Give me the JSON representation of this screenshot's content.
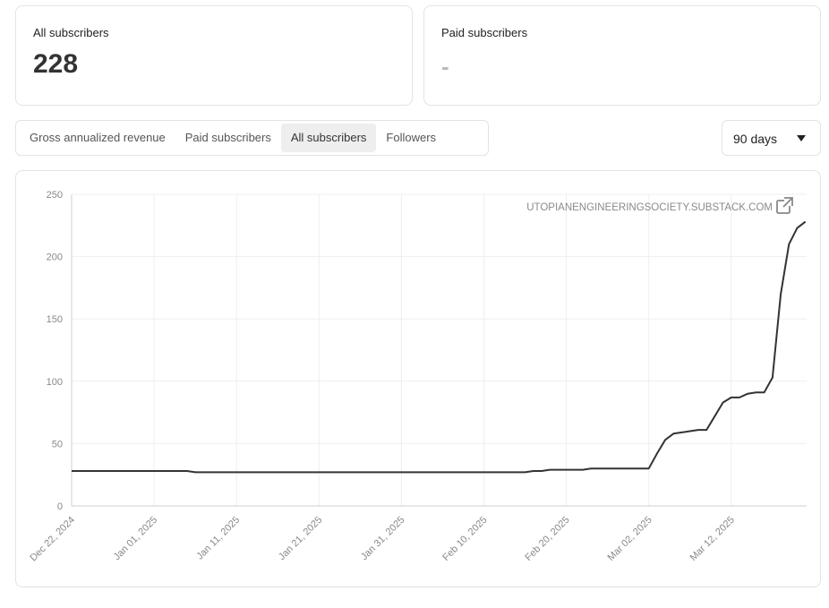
{
  "stats": {
    "all_subscribers": {
      "label": "All subscribers",
      "value": "228"
    },
    "paid_subscribers": {
      "label": "Paid subscribers",
      "value": "-"
    }
  },
  "tabs": [
    {
      "label": "Gross annualized revenue",
      "active": false
    },
    {
      "label": "Paid subscribers",
      "active": false
    },
    {
      "label": "All subscribers",
      "active": true
    },
    {
      "label": "Followers",
      "active": false
    }
  ],
  "range": {
    "selected": "90 days"
  },
  "watermark": {
    "text": "UTOPIANENGINEERINGSOCIETY.SUBSTACK.COM",
    "icon": "external-link-icon"
  },
  "chart_data": {
    "type": "line",
    "ylim": [
      0,
      250
    ],
    "yticks": [
      "250",
      "200",
      "150",
      "100",
      "50",
      "0"
    ],
    "xticks": [
      "Dec 22, 2024",
      "Jan 01, 2025",
      "Jan 11, 2025",
      "Jan 21, 2025",
      "Jan 31, 2025",
      "Feb 10, 2025",
      "Feb 20, 2025",
      "Mar 02, 2025",
      "Mar 12, 2025"
    ],
    "grid": true,
    "series": [
      {
        "color": "#333333",
        "points": [
          [
            "2024-12-22",
            28
          ],
          [
            "2025-01-05",
            28
          ],
          [
            "2025-01-06",
            27
          ],
          [
            "2025-02-15",
            27
          ],
          [
            "2025-02-16",
            28
          ],
          [
            "2025-02-17",
            28
          ],
          [
            "2025-02-18",
            29
          ],
          [
            "2025-02-22",
            29
          ],
          [
            "2025-02-23",
            30
          ],
          [
            "2025-03-02",
            30
          ],
          [
            "2025-03-03",
            42
          ],
          [
            "2025-03-04",
            53
          ],
          [
            "2025-03-05",
            58
          ],
          [
            "2025-03-06",
            59
          ],
          [
            "2025-03-07",
            60
          ],
          [
            "2025-03-08",
            61
          ],
          [
            "2025-03-09",
            61
          ],
          [
            "2025-03-10",
            72
          ],
          [
            "2025-03-11",
            83
          ],
          [
            "2025-03-12",
            87
          ],
          [
            "2025-03-13",
            87
          ],
          [
            "2025-03-14",
            90
          ],
          [
            "2025-03-15",
            91
          ],
          [
            "2025-03-16",
            91
          ],
          [
            "2025-03-17",
            103
          ],
          [
            "2025-03-18",
            170
          ],
          [
            "2025-03-19",
            210
          ],
          [
            "2025-03-20",
            223
          ],
          [
            "2025-03-21",
            228
          ]
        ]
      }
    ]
  }
}
